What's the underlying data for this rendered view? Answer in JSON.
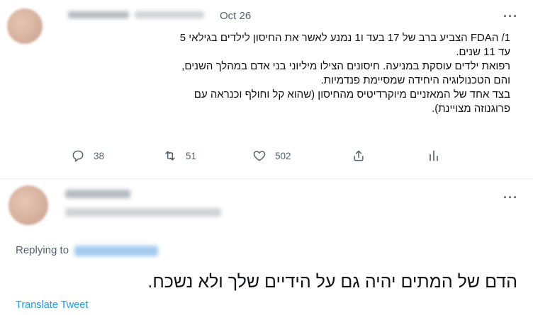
{
  "tweet1": {
    "date": "Oct 26",
    "lines": [
      "1/ הFDA הצביע ברב של 17 בעד ו1 נמנע לאשר את החיסון לילדים בגילאי 5",
      "עד 11 שנים.",
      "רפואת ילדים עוסקת במניעה. חיסונים הצילו מיליוני בני אדם במהלך השנים,",
      "והם הטכנולוגיה היחידה שמסיימת פנדמיות.",
      "בצד אחד של המאזניים מיוקרדיטיס מהחיסון (שהוא קל וחולף וכנראה עם",
      "פרוגנוזה מצויינת)."
    ],
    "actions": {
      "reply_count": "38",
      "retweet_count": "51",
      "like_count": "502"
    }
  },
  "reply": {
    "replying_to_label": "Replying to",
    "text": "הדם של המתים יהיה גם על הידיים שלך ולא נשכח.",
    "translate_label": "Translate Tweet"
  },
  "icons": {
    "more": "more-dots-icon",
    "reply": "reply-icon",
    "retweet": "retweet-icon",
    "like": "heart-icon",
    "share": "share-icon",
    "analytics": "analytics-icon"
  },
  "colors": {
    "text": "#0f1419",
    "secondary": "#536471",
    "link": "#1d9bf0",
    "divider": "#eff3f4"
  }
}
